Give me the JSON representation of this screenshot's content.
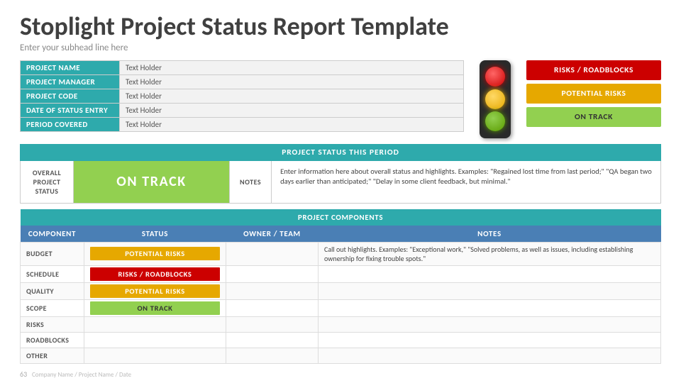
{
  "header": {
    "title": "Stoplight Project Status Report Template",
    "subtitle": "Enter your subhead line here"
  },
  "info_rows": [
    {
      "label": "PROJECT NAME",
      "value": "Text Holder"
    },
    {
      "label": "PROJECT MANAGER",
      "value": "Text Holder"
    },
    {
      "label": "PROJECT CODE",
      "value": "Text Holder"
    },
    {
      "label": "DATE OF STATUS ENTRY",
      "value": "Text Holder"
    },
    {
      "label": "PERIOD COVERED",
      "value": "Text Holder"
    }
  ],
  "legend": [
    {
      "label": "RISKS / ROADBLOCKS",
      "type": "red"
    },
    {
      "label": "POTENTIAL RISKS",
      "type": "yellow"
    },
    {
      "label": "ON TRACK",
      "type": "green"
    }
  ],
  "project_status": {
    "section_header": "PROJECT STATUS THIS PERIOD",
    "overall_label": "OVERALL\nPROJECT\nSTATUS",
    "overall_value": "ON TRACK",
    "notes_label": "NOTES",
    "notes_text": "Enter information here about overall status and highlights. Examples: \"Regained lost time from last period;\" \"QA began two days earlier than anticipated;\" \"Delay in some client feedback, but minimal.\""
  },
  "components": {
    "section_header": "PROJECT COMPONENTS",
    "columns": [
      "COMPONENT",
      "STATUS",
      "OWNER / TEAM",
      "NOTES"
    ],
    "rows": [
      {
        "component": "BUDGET",
        "status": "POTENTIAL RISKS",
        "status_type": "yellow",
        "owner": "",
        "notes": "Call out highlights. Examples: \"Exceptional work,\" \"Solved problems, as well as issues, including establishing ownership for fixing trouble spots.\""
      },
      {
        "component": "SCHEDULE",
        "status": "RISKS / ROADBLOCKS",
        "status_type": "red",
        "owner": "",
        "notes": ""
      },
      {
        "component": "QUALITY",
        "status": "POTENTIAL RISKS",
        "status_type": "yellow",
        "owner": "",
        "notes": ""
      },
      {
        "component": "SCOPE",
        "status": "ON TRACK",
        "status_type": "green",
        "owner": "",
        "notes": ""
      },
      {
        "component": "RISKS",
        "status": "",
        "status_type": "",
        "owner": "",
        "notes": ""
      },
      {
        "component": "ROADBLOCKS",
        "status": "",
        "status_type": "",
        "owner": "",
        "notes": ""
      },
      {
        "component": "OTHER",
        "status": "",
        "status_type": "",
        "owner": "",
        "notes": ""
      }
    ]
  },
  "footer": {
    "page_number": "63",
    "company": "Company Name / Project Name / Date"
  }
}
